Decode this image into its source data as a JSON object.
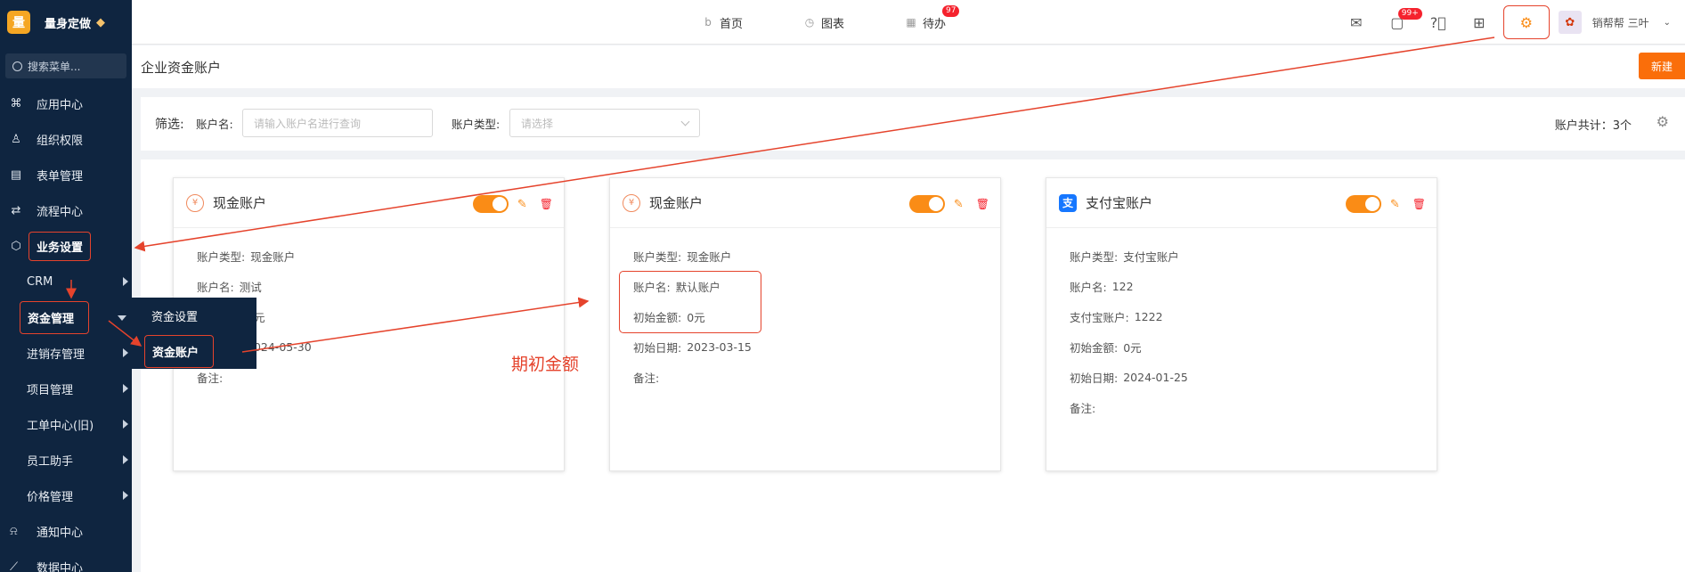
{
  "app": {
    "logo_char": "量",
    "name": "量身定做"
  },
  "sidebar": {
    "search_placeholder": "搜索菜单...",
    "items": [
      {
        "label": "应用中心",
        "icon": "apps-icon"
      },
      {
        "label": "组织权限",
        "icon": "user-icon"
      },
      {
        "label": "表单管理",
        "icon": "form-icon"
      },
      {
        "label": "流程中心",
        "icon": "flow-icon"
      },
      {
        "label": "业务设置",
        "icon": "cube-icon"
      }
    ],
    "sub_items": [
      {
        "label": "CRM"
      },
      {
        "label": "资金管理"
      },
      {
        "label": "进销存管理"
      },
      {
        "label": "项目管理"
      },
      {
        "label": "工单中心(旧)"
      },
      {
        "label": "员工助手"
      },
      {
        "label": "价格管理"
      }
    ],
    "bottom_items": [
      {
        "label": "通知中心"
      },
      {
        "label": "数据中心"
      }
    ]
  },
  "flyout": {
    "items": [
      {
        "label": "资金设置"
      },
      {
        "label": "资金账户"
      }
    ]
  },
  "topbar": {
    "tabs": [
      {
        "label": "首页"
      },
      {
        "label": "图表"
      },
      {
        "label": "待办",
        "badge": "97"
      }
    ],
    "message_badge": "99+",
    "user": {
      "name": "销帮帮 三叶"
    }
  },
  "page": {
    "title": "企业资金账户",
    "new_button": "新建"
  },
  "filter": {
    "label": "筛选:",
    "name_label": "账户名:",
    "name_placeholder": "请输入账户名进行查询",
    "type_label": "账户类型:",
    "type_placeholder": "请选择",
    "count": "账户共计：3个"
  },
  "cards": [
    {
      "title": "现金账户",
      "fields": [
        {
          "label": "账户类型:",
          "value": "现金账户"
        },
        {
          "label": "账户名:",
          "value": "测试"
        },
        {
          "label": "",
          "value": "元"
        },
        {
          "label": "",
          "value": "2024-05-30"
        },
        {
          "label": "备注:",
          "value": ""
        }
      ]
    },
    {
      "title": "现金账户",
      "fields": [
        {
          "label": "账户类型:",
          "value": "现金账户"
        },
        {
          "label": "账户名:",
          "value": "默认账户"
        },
        {
          "label": "初始金额:",
          "value": "0元"
        },
        {
          "label": "初始日期:",
          "value": "2023-03-15"
        },
        {
          "label": "备注:",
          "value": ""
        }
      ]
    },
    {
      "title": "支付宝账户",
      "fields": [
        {
          "label": "账户类型:",
          "value": "支付宝账户"
        },
        {
          "label": "账户名:",
          "value": "122"
        },
        {
          "label": "支付宝账户:",
          "value": "1222"
        },
        {
          "label": "初始金额:",
          "value": "0元"
        },
        {
          "label": "初始日期:",
          "value": "2024-01-25"
        },
        {
          "label": "备注:",
          "value": ""
        }
      ]
    }
  ],
  "annotation": {
    "text": "期初金额"
  },
  "colors": {
    "sidebar": "#0f2540",
    "accent": "#fa8c16",
    "annotation": "#e5432c"
  }
}
